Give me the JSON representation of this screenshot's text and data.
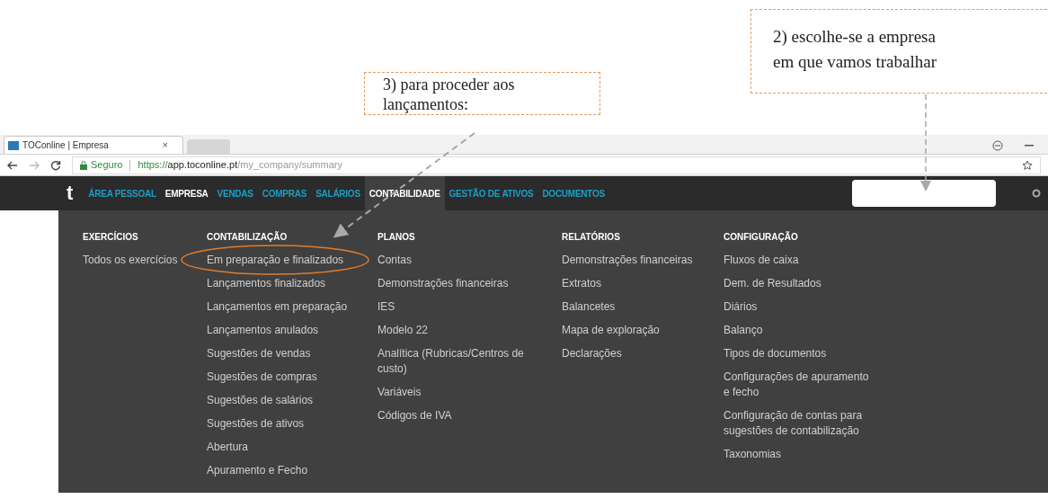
{
  "annotations": [
    {
      "lines": [
        "3) para proceder aos",
        "lançamentos:"
      ]
    },
    {
      "lines": [
        "2) escolhe-se a empresa",
        "em que vamos trabalhar"
      ]
    }
  ],
  "browser": {
    "tab_title": "TOConline | Empresa",
    "tab_close": "×",
    "security": "Seguro",
    "url_scheme": "https://",
    "url_host": "app.toconline.pt",
    "url_path": "/my_company/summary"
  },
  "nav": {
    "logo": "t",
    "items": [
      {
        "label": "ÁREA PESSOAL",
        "selected": false,
        "expanded": false
      },
      {
        "label": "EMPRESA",
        "selected": true,
        "expanded": false
      },
      {
        "label": "VENDAS",
        "selected": false,
        "expanded": false
      },
      {
        "label": "COMPRAS",
        "selected": false,
        "expanded": false
      },
      {
        "label": "SALÁRIOS",
        "selected": false,
        "expanded": false
      },
      {
        "label": "CONTABILIDADE",
        "selected": true,
        "expanded": true
      },
      {
        "label": "GESTÃO DE ATIVOS",
        "selected": false,
        "expanded": false
      },
      {
        "label": "DOCUMENTOS",
        "selected": false,
        "expanded": false
      }
    ]
  },
  "menu": {
    "columns": [
      {
        "heading": "EXERCÍCIOS",
        "items": [
          "Todos os exercícios"
        ]
      },
      {
        "heading": "CONTABILIZAÇÃO",
        "items": [
          "Em preparação e finalizados",
          "Lançamentos finalizados",
          "Lançamentos em preparação",
          "Lançamentos anulados",
          "Sugestões de vendas",
          "Sugestões de compras",
          "Sugestões de salários",
          "Sugestões de ativos",
          "Abertura",
          "Apuramento e Fecho"
        ]
      },
      {
        "heading": "PLANOS",
        "items": [
          "Contas",
          "Demonstrações financeiras",
          "IES",
          "Modelo 22",
          "Analítica (Rubricas/Centros de custo)",
          "Variáveis",
          "Códigos de IVA"
        ]
      },
      {
        "heading": "RELATÓRIOS",
        "items": [
          "Demonstrações financeiras",
          "Extratos",
          "Balancetes",
          "Mapa de exploração",
          "Declarações"
        ]
      },
      {
        "heading": "CONFIGURAÇÃO",
        "items": [
          "Fluxos de caixa",
          "Dem. de Resultados",
          "Diários",
          "Balanço",
          "Tipos de documentos",
          "Configurações de apuramento e fecho",
          "Configuração de contas para sugestões de contabilização",
          "Taxonomias"
        ]
      }
    ]
  }
}
